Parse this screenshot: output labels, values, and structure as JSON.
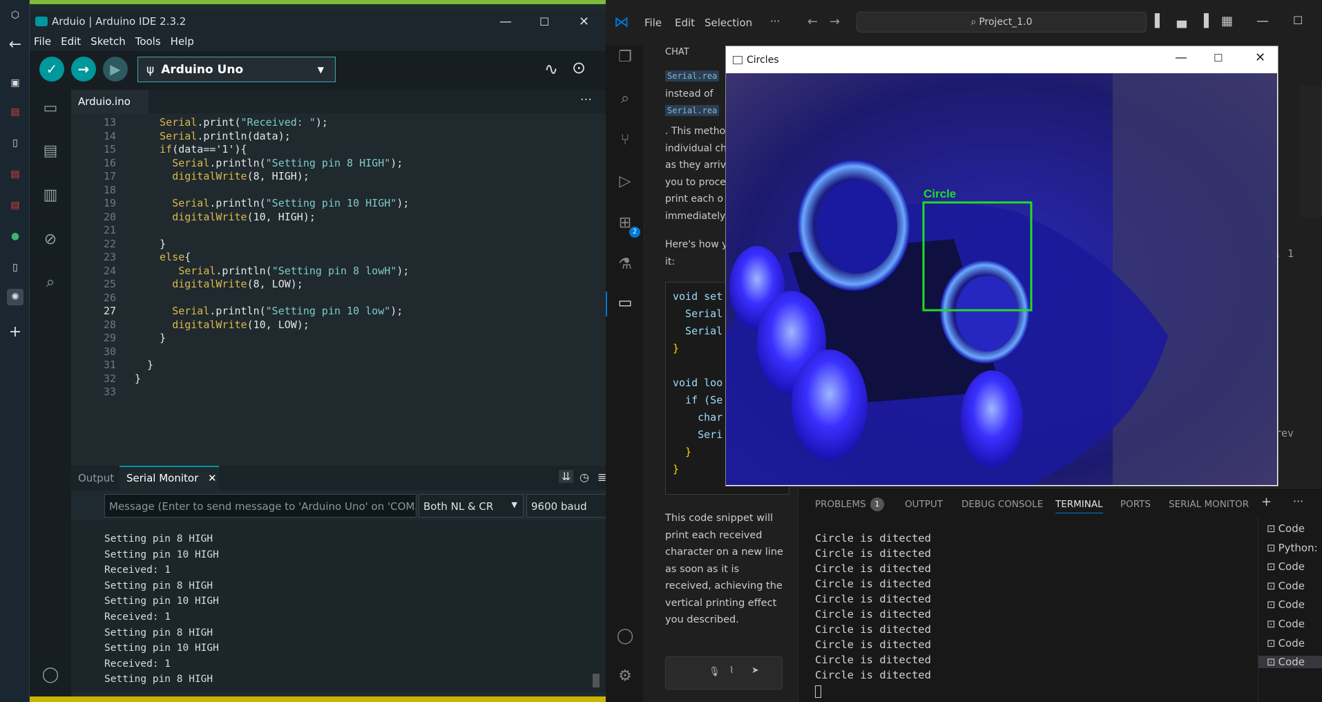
{
  "arduino": {
    "window_title": "Arduio | Arduino IDE 2.3.2",
    "menu": [
      "File",
      "Edit",
      "Sketch",
      "Tools",
      "Help"
    ],
    "board": "Arduino Uno",
    "tab": "Arduio.ino",
    "code": [
      {
        "n": "13",
        "t": "    Serial.print(\"Received: \");"
      },
      {
        "n": "14",
        "t": "    Serial.println(data);"
      },
      {
        "n": "15",
        "t": "    if(data=='1'){"
      },
      {
        "n": "16",
        "t": "      Serial.println(\"Setting pin 8 HIGH\");"
      },
      {
        "n": "17",
        "t": "      digitalWrite(8, HIGH);"
      },
      {
        "n": "18",
        "t": ""
      },
      {
        "n": "19",
        "t": "      Serial.println(\"Setting pin 10 HIGH\");"
      },
      {
        "n": "20",
        "t": "      digitalWrite(10, HIGH);"
      },
      {
        "n": "21",
        "t": ""
      },
      {
        "n": "22",
        "t": "    }"
      },
      {
        "n": "23",
        "t": "    else{"
      },
      {
        "n": "24",
        "t": "       Serial.println(\"Setting pin 8 lowH\");"
      },
      {
        "n": "25",
        "t": "      digitalWrite(8, LOW);"
      },
      {
        "n": "26",
        "t": ""
      },
      {
        "n": "27",
        "t": "      Serial.println(\"Setting pin 10 low\");"
      },
      {
        "n": "28",
        "t": "      digitalWrite(10, LOW);"
      },
      {
        "n": "29",
        "t": "    }"
      },
      {
        "n": "30",
        "t": ""
      },
      {
        "n": "31",
        "t": "  }"
      },
      {
        "n": "32",
        "t": "}"
      },
      {
        "n": "33",
        "t": ""
      }
    ],
    "active_line": "27",
    "output_tab": "Output",
    "serial_tab": "Serial Monitor",
    "serial_placeholder": "Message (Enter to send message to 'Arduino Uno' on 'COM5'",
    "line_ending": "Both NL & CR",
    "baud": "9600 baud",
    "serial_lines": [
      "Setting pin 8 HIGH",
      "Setting pin 10 HIGH",
      "Received: 1",
      "Setting pin 8 HIGH",
      "Setting pin 10 HIGH",
      "Received: 1",
      "Setting pin 8 HIGH",
      "Setting pin 10 HIGH",
      "Received: 1",
      "Setting pin 8 HIGH"
    ]
  },
  "vscode": {
    "menu": [
      "File",
      "Edit",
      "Selection",
      "···"
    ],
    "search": "Project_1.0",
    "chat_header": "CHAT",
    "chat_code_tag1": "Serial.rea",
    "chat_instead": "instead of",
    "chat_code_tag2": "Serial.rea",
    "chat_para1": [
      ". This metho",
      "individual ch",
      "as they arriv",
      "you to proce",
      "print each o",
      "immediately"
    ],
    "chat_para2": [
      "Here's how y",
      "it:"
    ],
    "chat_code": [
      "void set",
      "  Serial",
      "  Serial",
      "}",
      "",
      "void loo",
      "  if (Se",
      "    char",
      "    Seri",
      "  }",
      "}"
    ],
    "chat_para3": [
      "This code snippet will",
      "print each received",
      "character on a new line",
      "as soon as it is",
      "received, achieving the",
      "vertical printing effect",
      "you described."
    ],
    "extensions_badge": "2",
    "panel_tabs": [
      "PROBLEMS",
      "OUTPUT",
      "DEBUG CONSOLE",
      "TERMINAL",
      "PORTS",
      "SERIAL MONITOR"
    ],
    "problems_count": "1",
    "terminal_lines": [
      "Circle is ditected",
      "Circle is ditected",
      "Circle is ditected",
      "Circle is ditected",
      "Circle is ditected",
      "Circle is ditected",
      "Circle is ditected",
      "Circle is ditected",
      "Circle is ditected",
      "Circle is ditected"
    ],
    "terminal_list": [
      "Code",
      "Python:",
      "Code",
      "Code",
      "Code",
      "Code",
      "Code",
      "Code"
    ],
    "editor_stub_1": ", 1",
    "editor_stub_2": "rev"
  },
  "popup": {
    "title": "Circles",
    "detection_label": "Circle"
  },
  "colors": {
    "arduino_accent": "#00878f",
    "detect_box": "#22dd22",
    "vs_accent": "#0078d4"
  }
}
